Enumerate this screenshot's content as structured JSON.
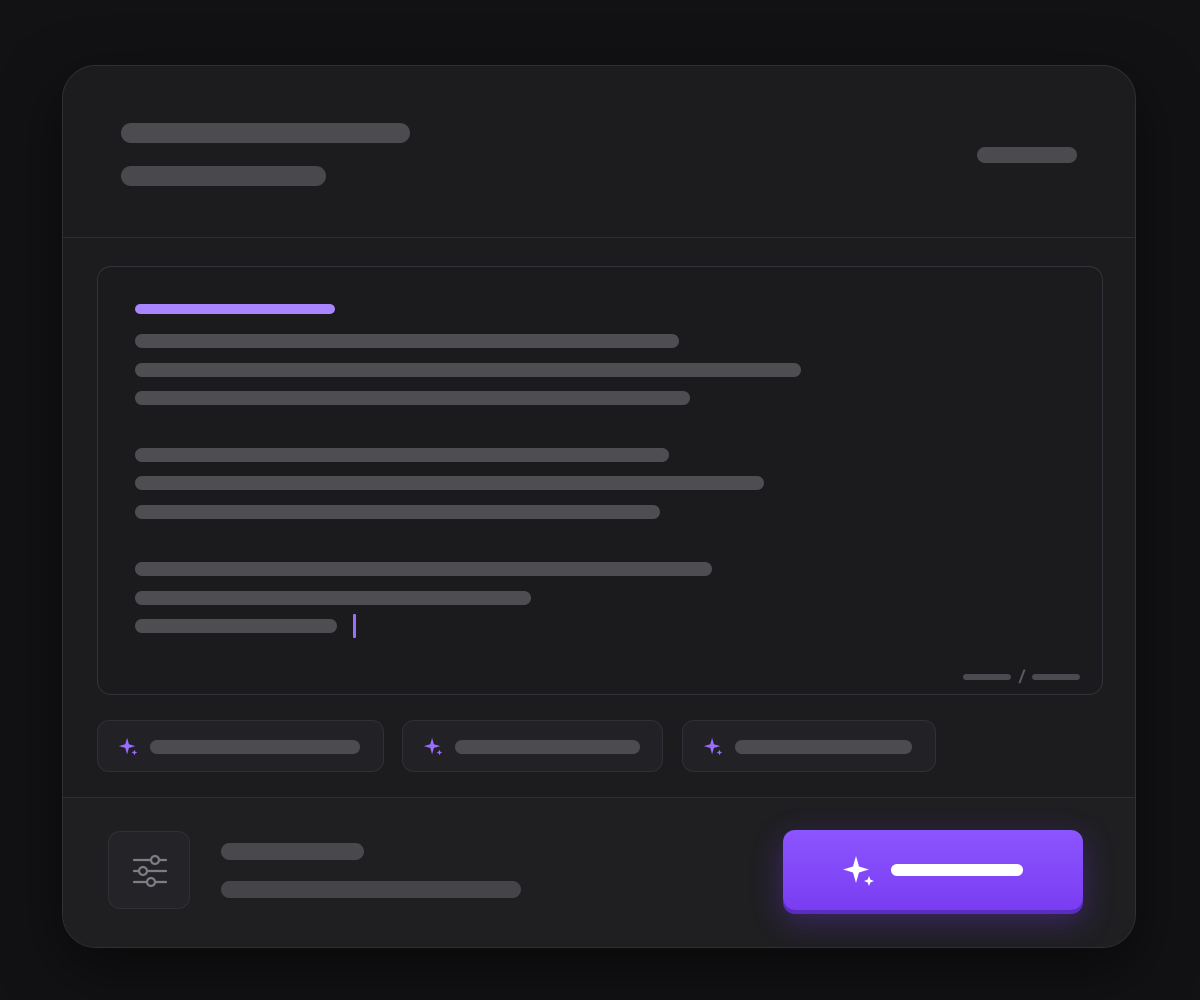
{
  "colors": {
    "page_background": "#121214",
    "card_background": "#1c1c1f",
    "accent": "#8b55ff",
    "placeholder_bar": "#4a4a4f"
  },
  "header": {
    "title_placeholder": "",
    "subtitle_placeholder": "",
    "action_icon": "text-placeholder"
  },
  "editor": {
    "heading_color": "#a986ff",
    "paragraph_count": 3,
    "caret_visible": true,
    "counter_separator": "/"
  },
  "suggestions": [
    {
      "icon": "sparkles-icon"
    },
    {
      "icon": "sparkles-icon"
    },
    {
      "icon": "sparkles-icon"
    }
  ],
  "footer": {
    "settings_icon": "sliders-icon",
    "generate_icon": "sparkles-icon",
    "generate_color": "#8b55ff"
  }
}
